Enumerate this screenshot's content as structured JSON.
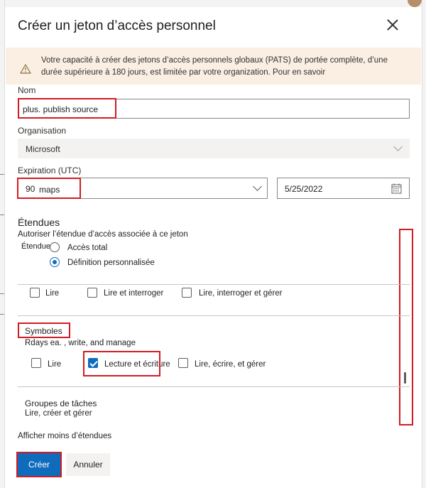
{
  "dialog": {
    "title": "Créer un jeton d’accès personnel",
    "warning": "Votre capacité à créer des jetons d’accès personnels globaux (PATS) de portée complète, d’une durée supérieure à 180 jours, est limitée par votre organization. Pour en savoir"
  },
  "name": {
    "label": "Nom",
    "value": "plus. publish source"
  },
  "organization": {
    "label": "Organisation",
    "value": "Microsoft"
  },
  "expiration": {
    "label": "Expiration (UTC)",
    "days_value": "90",
    "days_unit": "maps",
    "date_value": "5/25/2022"
  },
  "scopes": {
    "heading": "Étendues",
    "description": "Autoriser l’étendue d’accès associée à ce jeton",
    "small_label": "Étendues",
    "options": [
      "Accès total",
      "Définition personnalisée"
    ],
    "selected": "Définition personnalisée",
    "first_row": [
      "Lire",
      "Lire et interroger",
      "Lire, interroger et gérer"
    ],
    "symbols": {
      "title": "Symboles",
      "subtitle": "Rdays ea. , write, and manage",
      "options": [
        "Lire",
        "Lecture et écriture",
        "Lire, écrire, et gérer"
      ],
      "checked": "Lecture et écriture"
    },
    "task_groups": {
      "title": "Groupes de tâches",
      "subtitle": "Lire, créer et gérer"
    },
    "show_less": "Afficher moins d’étendues"
  },
  "buttons": {
    "create": "Créer",
    "cancel": "Annuler"
  },
  "colors": {
    "accent": "#0f6cbd",
    "highlight": "#d21b24",
    "warning_bg": "#fbefe4"
  },
  "icons": [
    "warning-icon",
    "close-icon",
    "chevron-down-icon",
    "calendar-icon"
  ]
}
